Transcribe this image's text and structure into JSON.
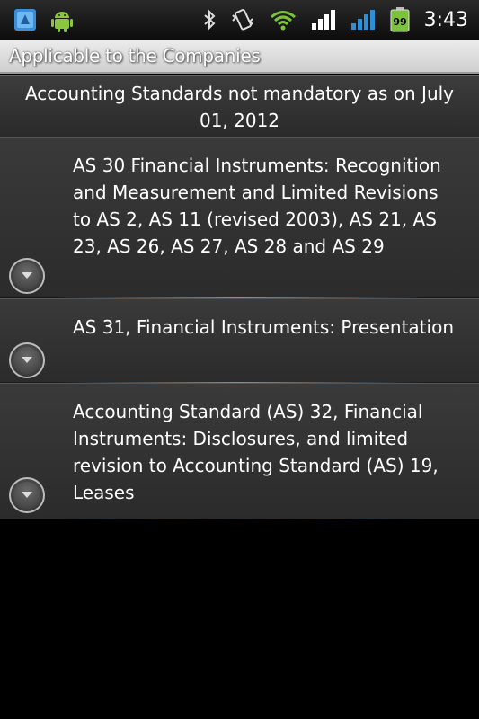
{
  "status_bar": {
    "time": "3:43",
    "battery_level": "99",
    "icons": [
      "bluetooth-icon",
      "vibrate-icon",
      "wifi-icon",
      "signal-icon",
      "data-signal-icon",
      "battery-icon"
    ],
    "notification_icons": [
      "app-notification-icon",
      "android-icon"
    ]
  },
  "title_bar": {
    "title": "Applicable to the Companies"
  },
  "header": {
    "title": "Accounting Standards not mandatory as on July 01, 2012"
  },
  "list": {
    "items": [
      {
        "label": "AS 30 Financial Instruments: Recognition and Measurement and Limited Revisions to AS 2, AS 11 (revised 2003), AS 21, AS 23, AS 26, AS 27, AS 28 and AS 29"
      },
      {
        "label": "AS 31, Financial Instruments: Presentation"
      },
      {
        "label": "Accounting Standard (AS) 32, Financial Instruments: Disclosures, and limited revision to Accounting Standard (AS) 19, Leases"
      }
    ]
  },
  "colors": {
    "accent": "#3fa9f5",
    "signal_green": "#7bc43a",
    "signal_blue": "#2f8fd6"
  }
}
